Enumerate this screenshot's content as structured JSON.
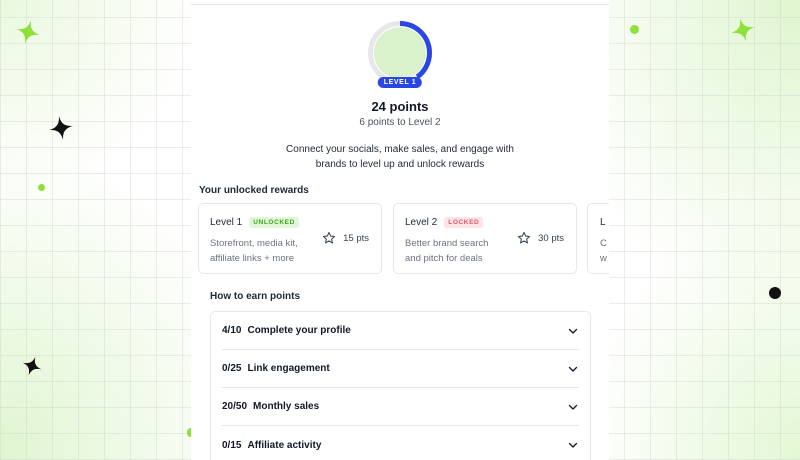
{
  "progress": {
    "level_badge": "LEVEL 1",
    "ring_fraction": 0.4,
    "colors": {
      "track": "#e5e7eb",
      "fill": "#2b46e3",
      "inner": "#d9f2cc"
    }
  },
  "points": {
    "title": "24 points",
    "subtitle": "6 points to Level 2"
  },
  "description": {
    "line1": "Connect your socials, make sales, and engage with",
    "line2": "brands to level up and unlock rewards"
  },
  "rewards": {
    "heading": "Your unlocked rewards",
    "cards": [
      {
        "level": "Level 1",
        "status": "UNLOCKED",
        "desc_line1": "Storefront, media kit,",
        "desc_line2": "affiliate links + more",
        "pts": "15 pts"
      },
      {
        "level": "Level 2",
        "status": "LOCKED",
        "desc_line1": "Better brand search",
        "desc_line2": "and pitch for deals",
        "pts": "30 pts"
      },
      {
        "level": "L",
        "status": "",
        "desc_line1": "C",
        "desc_line2": "w",
        "pts": ""
      }
    ]
  },
  "earn": {
    "heading": "How to earn points",
    "rows": [
      {
        "progress": "4/10",
        "label": "Complete your profile"
      },
      {
        "progress": "0/25",
        "label": "Link engagement"
      },
      {
        "progress": "20/50",
        "label": "Monthly sales"
      },
      {
        "progress": "0/15",
        "label": "Affiliate activity"
      }
    ]
  },
  "icons": {
    "star": "star-outline-icon",
    "chevron": "chevron-down-icon",
    "sparkle": "sparkle-icon"
  },
  "colors": {
    "accent_blue": "#2b46e3",
    "lime": "#8ee03a",
    "unlocked_green": "#3aa617",
    "locked_red": "#e1566a"
  }
}
